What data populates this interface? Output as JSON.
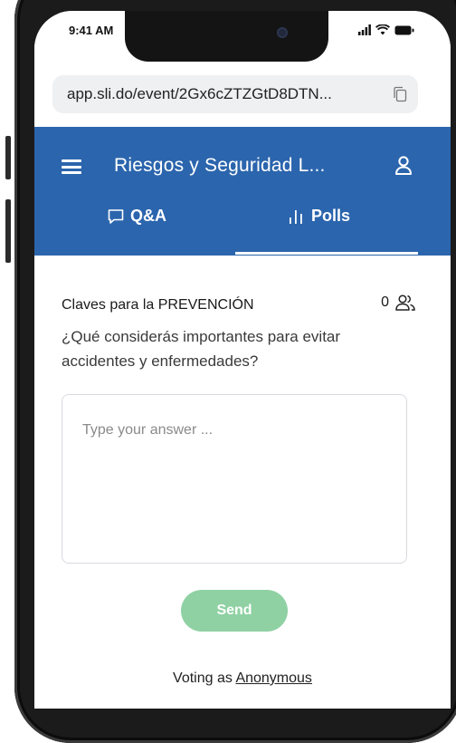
{
  "status_bar": {
    "time": "9:41 AM",
    "icons": [
      "signal-icon",
      "wifi-icon",
      "battery-icon"
    ]
  },
  "browser": {
    "url": "app.sli.do/event/2Gx6cZTZGtD8DTN..."
  },
  "header": {
    "title": "Riesgos y Seguridad L...",
    "background_color": "#2b65ad"
  },
  "tabs": [
    {
      "label": "Q&A",
      "icon": "chat-bubble-icon",
      "active": false
    },
    {
      "label": "Polls",
      "icon": "bar-chart-icon",
      "active": true
    }
  ],
  "poll": {
    "title": "Claves para la PREVENCIÓN",
    "participant_count": "0",
    "question": "¿Qué considerás importantes para evitar accidentes y enfermedades?",
    "answer_placeholder": "Type your answer ...",
    "send_label": "Send",
    "send_color": "#8fd1a3"
  },
  "footer": {
    "voting_prefix": "Voting as",
    "voting_name": "Anonymous"
  }
}
